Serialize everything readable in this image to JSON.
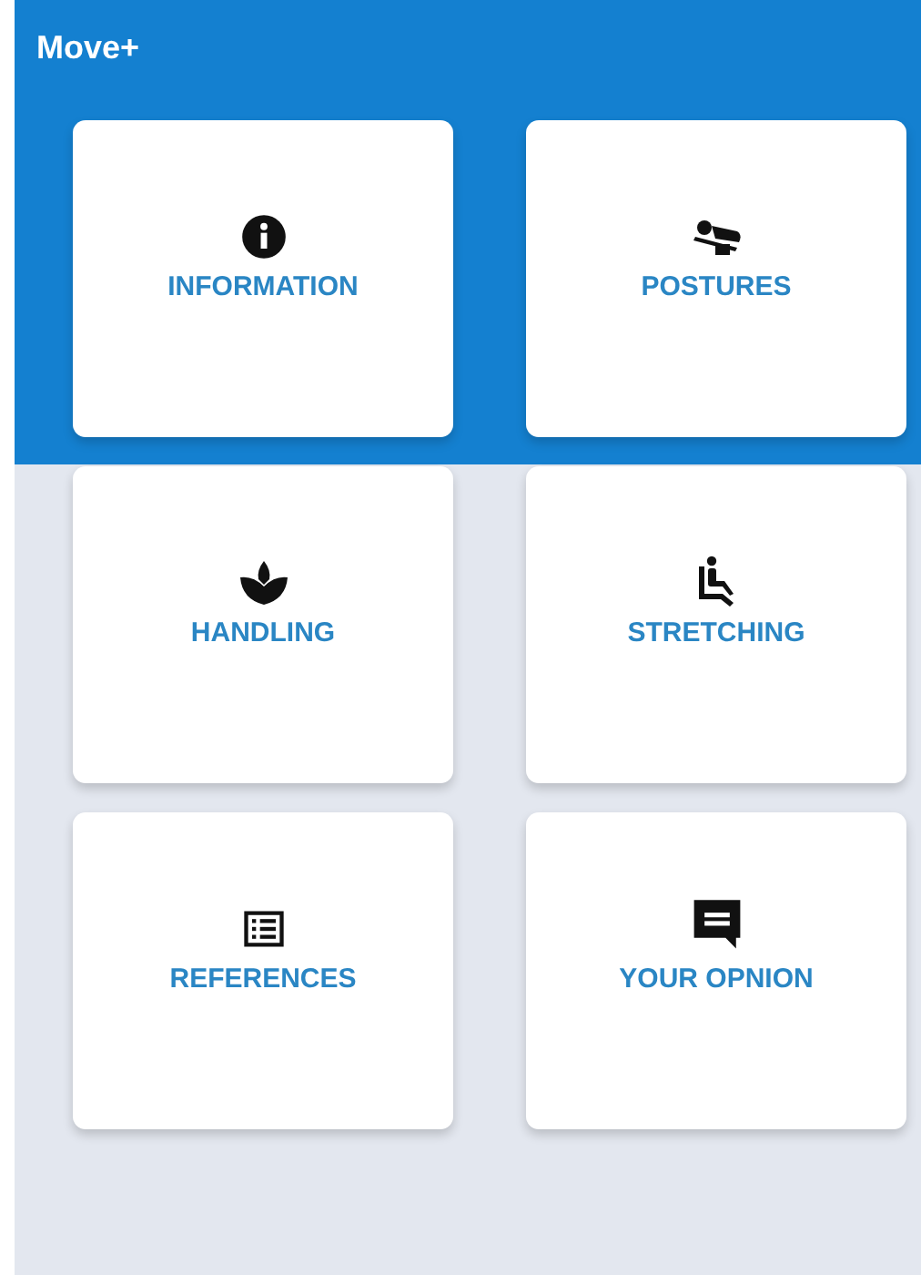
{
  "app_bar": {
    "title": "Move+"
  },
  "tiles": [
    {
      "label": "INFORMATION"
    },
    {
      "label": "POSTURES"
    },
    {
      "label": "HANDLING"
    },
    {
      "label": "STRETCHING"
    },
    {
      "label": "REFERENCES"
    },
    {
      "label": "YOUR OPNION"
    }
  ]
}
